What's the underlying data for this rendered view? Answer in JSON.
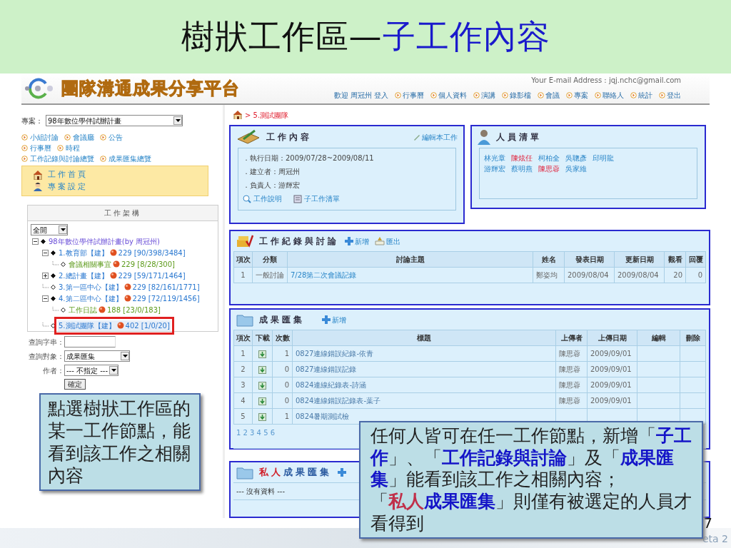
{
  "slide": {
    "title": [
      {
        "text": "樹狀工作區—"
      },
      {
        "text": "子工作內容",
        "color": "#1a1acc"
      }
    ],
    "page_number": "7",
    "footer": "eta 2"
  },
  "site": {
    "logo_text": "團隊溝通成果分享平台",
    "email": "Your E-mail Address : jqj.nchc@gmail.com",
    "welcome": "歡迎 周冠州 登入",
    "nav": [
      "行事曆",
      "個人資料",
      "演講",
      "錄影檔",
      "會議",
      "專案",
      "聯絡人",
      "統計",
      "登出"
    ]
  },
  "sidebar": {
    "project_label": "專案：",
    "project_value": "98年數位學伴試辦計畫",
    "link_rows": [
      [
        "小組討論",
        "會議廳",
        "公告"
      ],
      [
        "行事曆",
        "時程"
      ],
      [
        "工作記錄與討論總覽",
        "成果匯集總覽"
      ]
    ],
    "menu": [
      {
        "label": "工作首頁",
        "kind": "home"
      },
      {
        "label": "專案設定",
        "kind": "settings"
      }
    ],
    "tree": {
      "title": "工作架構",
      "filter": "全開",
      "nodes": [
        {
          "label": "98年數位學伴試辦計畫(by 周冠州)",
          "kind": "root",
          "expanded": true,
          "selected": false,
          "children": [
            {
              "label": "1.教育部【建】",
              "kind": "group",
              "count": "229",
              "stats": "[90/398/3484]",
              "expanded": true,
              "selected": false,
              "children": [
                {
                  "label": "會議相關事宜",
                  "kind": "note",
                  "count": "229",
                  "stats": "[8/28/300]",
                  "selected": false
                }
              ]
            },
            {
              "label": "2.總計畫【建】",
              "kind": "group",
              "count": "229",
              "stats": "[59/171/1464]",
              "expanded": false,
              "selected": false
            },
            {
              "label": "3.第一區中心【建】",
              "kind": "group",
              "count": "229",
              "stats": "[82/161/1771]",
              "selected": false
            },
            {
              "label": "4.第二區中心【建】",
              "kind": "group",
              "count": "229",
              "stats": "[72/119/1456]",
              "expanded": true,
              "selected": false,
              "children": [
                {
                  "label": "工作日誌",
                  "kind": "note",
                  "count": "188",
                  "stats": "[23/0/183]",
                  "selected": false
                }
              ]
            },
            {
              "label": "5.測試團隊【建】",
              "kind": "group",
              "count": "402",
              "stats": "[1/0/20]",
              "selected": true
            }
          ]
        }
      ]
    },
    "search": {
      "query_label": "查詢字串：",
      "target_label": "查詢對象：",
      "target_value": "成果匯集",
      "author_label": "作者：",
      "author_value": "--- 不指定 ---",
      "submit": "確定"
    }
  },
  "breadcrumb": "> 5.測試團隊",
  "work": {
    "title": "工作內容",
    "edit": "編輯本工作",
    "lines": [
      "．執行日期：2009/07/28~2009/08/11",
      "．建立者：周冠州",
      "．負責人：游輝宏"
    ],
    "links": [
      {
        "label": "工作說明",
        "kind": "zoom"
      },
      {
        "label": "子工作清單",
        "kind": "list"
      }
    ]
  },
  "people": {
    "title": "人員清單",
    "rows": [
      [
        {
          "name": "林光章",
          "highlighted": false
        },
        {
          "name": "陳炫任",
          "highlighted": true
        },
        {
          "name": "柯柏全",
          "highlighted": false
        },
        {
          "name": "吳聰彥",
          "highlighted": false
        },
        {
          "name": "邱明龍",
          "highlighted": false
        }
      ],
      [
        {
          "name": "游輝宏",
          "highlighted": false
        },
        {
          "name": "蔡明燕",
          "highlighted": false
        },
        {
          "name": "陳思蓉",
          "highlighted": true
        },
        {
          "name": "吳家維",
          "highlighted": false
        }
      ]
    ]
  },
  "discussion": {
    "title": "工作紀錄與討論",
    "add": "新增",
    "export": "匯出",
    "columns": [
      "項次",
      "分類",
      "討論主題",
      "姓名",
      "發表日期",
      "更新日期",
      "觀看",
      "回覆"
    ],
    "rows": [
      [
        "1",
        "一般討論",
        "7/28第二次會議記錄",
        "鄭姿均",
        "2009/08/04",
        "2009/08/04",
        "20",
        "0"
      ]
    ]
  },
  "results": {
    "title": "成果匯集",
    "add": "新增",
    "columns": [
      "項次",
      "下載",
      "次數",
      "標題",
      "上傳者",
      "上傳日期",
      "編輯",
      "刪除"
    ],
    "rows": [
      {
        "no": "1",
        "count": "1",
        "title": "0827連線錯誤紀錄-依青",
        "uploader": "陳思蓉",
        "date": "2009/09/01"
      },
      {
        "no": "2",
        "count": "0",
        "title": "0827連線錯誤記錄",
        "uploader": "陳思蓉",
        "date": "2009/09/01"
      },
      {
        "no": "3",
        "count": "0",
        "title": "0824連線紀錄表-詩涵",
        "uploader": "陳思蓉",
        "date": "2009/09/01"
      },
      {
        "no": "4",
        "count": "0",
        "title": "0824連線錯誤記錄表-葉子",
        "uploader": "陳思蓉",
        "date": "2009/09/01"
      },
      {
        "no": "5",
        "count": "1",
        "title": "0824暑期測試檢"
      }
    ],
    "pages": "1 2 3 4 5 6"
  },
  "private": {
    "title": [
      {
        "text": "私人",
        "color": "#d0202a"
      },
      {
        "text": "成果匯集",
        "color": "#2a5aa0"
      }
    ],
    "empty": "--- 沒有資料 ---"
  },
  "callouts": [
    {
      "kind": "left",
      "lines": [
        [
          {
            "text": "點選樹狀工作區的某一工作節點，能看到該工作之相關內容"
          }
        ]
      ]
    },
    {
      "kind": "right",
      "lines": [
        [
          {
            "text": "任何人皆可在任一工作節點，新增「"
          },
          {
            "text": "子工作",
            "color": "#1414c8"
          },
          {
            "text": "」、「"
          },
          {
            "text": "工作記錄與討論",
            "color": "#1414c8"
          },
          {
            "text": "」及「"
          },
          {
            "text": "成果匯集",
            "color": "#1414c8"
          },
          {
            "text": "」能看到該工作之相關內容；"
          }
        ],
        [
          {
            "text": "「"
          },
          {
            "text": "私人",
            "color": "#c0304a"
          },
          {
            "text": "成果匯集",
            "color": "#1414c8"
          },
          {
            "text": "」則僅有被選定的人員才看得到"
          }
        ]
      ]
    }
  ]
}
